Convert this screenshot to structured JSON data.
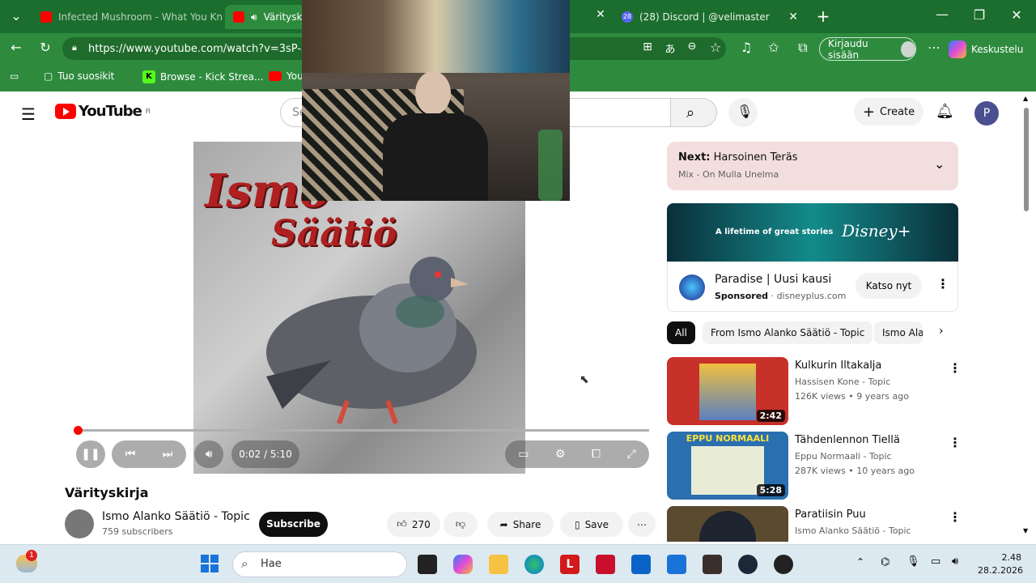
{
  "browser": {
    "tabs": [
      {
        "title": "Infected Mushroom - What You Kn",
        "active": false
      },
      {
        "title": "Värityskirja",
        "active": true
      },
      {
        "title": "(28) Discord | @velimaster",
        "active": false
      }
    ],
    "discord_badge": "28",
    "url": "https://www.youtube.com/watch?v=3sP-ak",
    "signin_label": "Kirjaudu sisään",
    "copilot_label": "Keskustelu",
    "bookmarks": [
      "Tuo suosikit",
      "Browse - Kick Strea...",
      "You"
    ]
  },
  "youtube": {
    "logo_text": "YouTube",
    "region": "FI",
    "search_placeholder": "Se",
    "create_label": "Create",
    "avatar_letter": "P"
  },
  "player": {
    "cover_line1": "Ismo",
    "cover_line2": "Säätiö",
    "time": "0:02 / 5:10",
    "progress": 0.0065
  },
  "video": {
    "title": "Värityskirja",
    "channel": "Ismo Alanko Säätiö - Topic",
    "subscribers": "759 subscribers",
    "subscribe_label": "Subscribe",
    "likes": "270",
    "share_label": "Share",
    "save_label": "Save"
  },
  "next": {
    "label": "Next:",
    "title": "Harsoinen Teräs",
    "subtitle": "Mix - On Mulla Unelma"
  },
  "ad": {
    "banner_text": "A lifetime of great stories",
    "brand": "Disney+",
    "title": "Paradise | Uusi kausi",
    "sponsored": "Sponsored",
    "domain": "disneyplus.com",
    "cta": "Katso nyt"
  },
  "chips": [
    "All",
    "From Ismo Alanko Säätiö - Topic",
    "Ismo Ala"
  ],
  "recommendations": [
    {
      "title": "Kulkurin Iltakalja",
      "channel": "Hassisen Kone - Topic",
      "meta": "126K views • 9 years ago",
      "duration": "2:42",
      "thumb_color": "#c8302a"
    },
    {
      "title": "Tähdenlennon Tiellä",
      "channel": "Eppu Normaali - Topic",
      "meta": "287K views • 10 years ago",
      "duration": "5:28",
      "thumb_color": "#2a6fb0",
      "thumb_text": "EPPU NORMAALI"
    },
    {
      "title": "Paratiisin Puu",
      "channel": "Ismo Alanko Säätiö - Topic",
      "meta": "",
      "duration": "",
      "thumb_color": "#5a4a30"
    }
  ],
  "taskbar": {
    "search_label": "Hae",
    "weather_badge": "1",
    "time": "2.48",
    "date": "28.2.2026"
  }
}
